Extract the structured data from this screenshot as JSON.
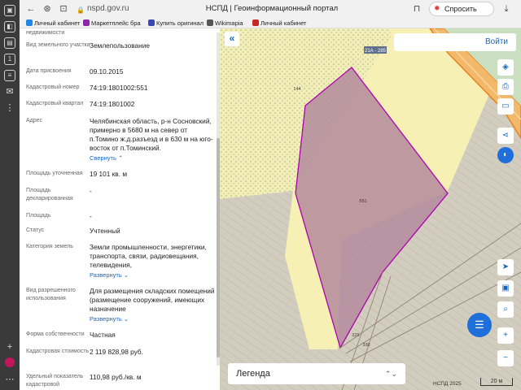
{
  "browser": {
    "url": "nspd.gov.ru",
    "page_title": "НСПД | Геоинформационный портал",
    "ask_label": "Спросить",
    "bookmarks": [
      {
        "label": "Личный кабинет",
        "color": "#1e88e5"
      },
      {
        "label": "Маркетплейс бра",
        "color": "#8e24aa"
      },
      {
        "label": "Купить оригинал",
        "color": "#3949ab"
      },
      {
        "label": "Wikimapia",
        "color": "#555555"
      },
      {
        "label": "Личный кабинет",
        "color": "#c62828"
      }
    ]
  },
  "panel": {
    "top_cut": "недвижимости",
    "rows": [
      {
        "label": "Вид земельного участка",
        "value": "Землепользование"
      },
      {
        "label": "Дата присвоения",
        "value": "09.10.2015"
      },
      {
        "label": "Кадастровый номер",
        "value": "74:19:1801002:551"
      },
      {
        "label": "Кадастровый квартал",
        "value": "74:19:1801002"
      },
      {
        "label": "Адрес",
        "value": "Челябинская область, р-н Сосновский, примерно в 5680 м на север от п.Томино ж.д.разъезд и в 630 м на юго-восток от п.Томинский.",
        "link": "Свернуть"
      },
      {
        "label": "Площадь уточненная",
        "value": "19 101 кв. м"
      },
      {
        "label": "Площадь декларированная",
        "value": "-"
      },
      {
        "label": "Площадь",
        "value": "-"
      },
      {
        "label": "Статус",
        "value": "Учтенный"
      },
      {
        "label": "Категория земель",
        "value": "Земли промышленности, энергетики, транспорта, связи, радиовещания, телевидения,",
        "link": "Развернуть"
      },
      {
        "label": "Вид разрешенного использования",
        "value": "Для размещения складских помещений (размещение сооружений, имеющих назначение",
        "link": "Развернуть"
      },
      {
        "label": "Форма собственности",
        "value": "Частная"
      },
      {
        "label": "Кадастровая стоимость",
        "value": "2 119 828,98 руб."
      },
      {
        "label": "Удельный показатель кадастровой",
        "value": "110,98 руб./кв. м"
      }
    ]
  },
  "map": {
    "login_label": "Войти",
    "legend_label": "Легенда",
    "copyright": "НСПД 2025",
    "scale_label": "20 м",
    "parcel_labels": {
      "main": "551",
      "north": "144",
      "south": "329",
      "south2": "330",
      "road": "21А - 285"
    },
    "colors": {
      "parcel_fill": "#b48a9c",
      "parcel_stroke": "#b000b0",
      "road": "#e8821e",
      "accent": "#1565c0"
    },
    "tools": [
      "layers-icon",
      "print-icon",
      "measure-icon",
      "share-icon",
      "theme-icon",
      "locate-icon",
      "screen-icon",
      "search-point-icon",
      "zoom-in-icon",
      "zoom-out-icon"
    ]
  }
}
